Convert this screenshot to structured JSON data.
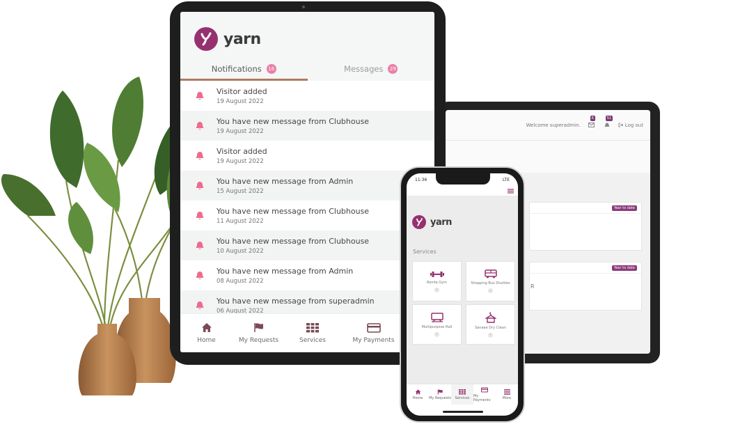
{
  "brand": {
    "name": "yarn",
    "accent_color": "#96316f",
    "badge_color": "#ea7fa8",
    "tab_underline_color": "#b07a5f"
  },
  "tablet": {
    "tabs": [
      {
        "label": "Notifications",
        "count": "16",
        "active": true
      },
      {
        "label": "Messages",
        "count": "29",
        "active": false
      }
    ],
    "notifications": [
      {
        "title": "Visitor added",
        "date": "19 August 2022",
        "icon": "bell-icon"
      },
      {
        "title": "You have new message from Clubhouse",
        "date": "19 August 2022",
        "icon": "bell-icon"
      },
      {
        "title": "Visitor added",
        "date": "19 August 2022",
        "icon": "bell-icon"
      },
      {
        "title": "You have new message from Admin",
        "date": "15 August 2022",
        "icon": "bell-icon"
      },
      {
        "title": "You have new message from Clubhouse",
        "date": "11 August 2022",
        "icon": "bell-icon"
      },
      {
        "title": "You have new message from Clubhouse",
        "date": "10 August 2022",
        "icon": "bell-icon"
      },
      {
        "title": "You have new message from Admin",
        "date": "08 August 2022",
        "icon": "bell-icon"
      },
      {
        "title": "You have new message from superadmin",
        "date": "06 August 2022",
        "icon": "bell-icon"
      }
    ],
    "nav": [
      {
        "label": "Home",
        "icon": "home-icon"
      },
      {
        "label": "My Requests",
        "icon": "flag-icon"
      },
      {
        "label": "Services",
        "icon": "grid-icon"
      },
      {
        "label": "My Payments",
        "icon": "card-icon"
      }
    ]
  },
  "laptop": {
    "welcome": "Welcome superadmin.",
    "mail_count": "6",
    "alert_count": "51",
    "logout": "Log out",
    "cards": [
      {
        "badge": "Year to date",
        "fragment": ""
      },
      {
        "badge": "Year to date",
        "fragment": "R"
      }
    ]
  },
  "phone": {
    "time": "11:36",
    "carrier": "LTE",
    "services_label": "Services",
    "services": [
      {
        "label": "Ronda Gym",
        "icon": "dumbbell-icon"
      },
      {
        "label": "Shopping Bus Shuttles",
        "icon": "bus-icon"
      },
      {
        "label": "Multipurpose Hall",
        "icon": "hall-icon"
      },
      {
        "label": "Sanaee Dry Clean",
        "icon": "laundry-icon"
      }
    ],
    "nav": [
      {
        "label": "Home",
        "icon": "home-icon"
      },
      {
        "label": "My Requests",
        "icon": "flag-icon"
      },
      {
        "label": "Services",
        "icon": "grid-icon",
        "active": true
      },
      {
        "label": "My Payments",
        "icon": "card-icon"
      },
      {
        "label": "More",
        "icon": "menu-icon"
      }
    ]
  }
}
